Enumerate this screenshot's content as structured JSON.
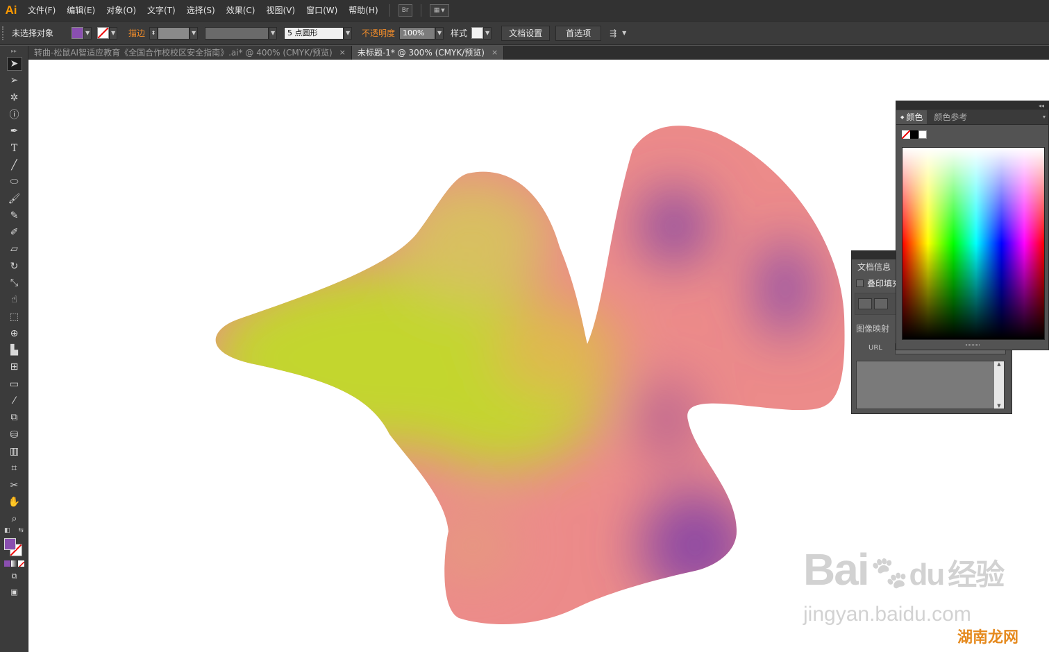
{
  "app": {
    "logo": "Ai"
  },
  "menu": [
    "文件(F)",
    "编辑(E)",
    "对象(O)",
    "文字(T)",
    "选择(S)",
    "效果(C)",
    "视图(V)",
    "窗口(W)",
    "帮助(H)"
  ],
  "menubar_buttons": {
    "bridge": "Br",
    "arrange": "▦"
  },
  "control": {
    "selection_label": "未选择对象",
    "fill_color": "#8a4fb0",
    "stroke_label": "描边",
    "brush_value": "5 点圆形",
    "opacity_label": "不透明度",
    "opacity_value": "100%",
    "style_label": "样式",
    "doc_setup_button": "文档设置",
    "preferences_button": "首选项"
  },
  "tabs": [
    {
      "label": "转曲-松鼠AI智适应教育《全国合作校校区安全指南》.ai* @ 400% (CMYK/预览)",
      "close": "×",
      "active": false
    },
    {
      "label": "未标题-1* @ 300% (CMYK/预览)",
      "close": "×",
      "active": true
    }
  ],
  "panels": {
    "docinfo": {
      "title": "文档信息",
      "overprint_label": "叠印填充",
      "imagemap_label": "图像映射",
      "url_label": "URL"
    },
    "color": {
      "tab_color": "颜色",
      "tab_guide": "颜色参考"
    }
  },
  "colors": {
    "accent_orange": "#f08c2a",
    "fill_purple": "#8a4fb0"
  },
  "watermarks": {
    "baidu": "Bai",
    "baidu_du": "du",
    "baidu_jingyan": "经验",
    "jingyan_url": "jingyan.baidu.com",
    "site": "湖南龙网"
  }
}
